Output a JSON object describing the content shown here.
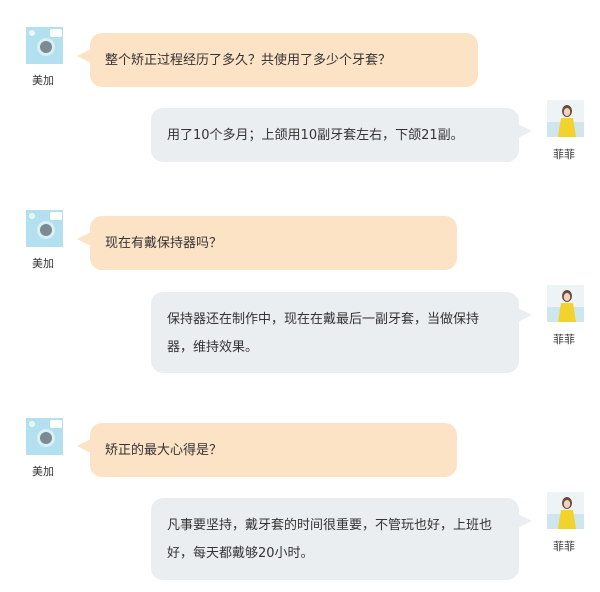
{
  "users": {
    "asker": {
      "name": "美加",
      "avatar_icon": "aligner-case-avatar-icon",
      "bubble_color": "#fde3c6"
    },
    "answerer": {
      "name": "菲菲",
      "avatar_icon": "woman-yellow-dress-avatar-icon",
      "bubble_color": "#ebeef1"
    }
  },
  "messages": [
    {
      "q": "整个矫正过程经历了多久？共使用了多少个牙套？",
      "a": "用了10个多月；上颌用10副牙套左右，下颌21副。"
    },
    {
      "q": "现在有戴保持器吗？",
      "a1": "保持器还在制作中，现在在戴最后一副牙套，当做保持",
      "a2": "器，维持效果。"
    },
    {
      "q": "矫正的最大心得是？",
      "a1": "凡事要坚持，戴牙套的时间很重要，不管玩也好，上班也",
      "a2": "好，每天都戴够20小时。"
    }
  ]
}
